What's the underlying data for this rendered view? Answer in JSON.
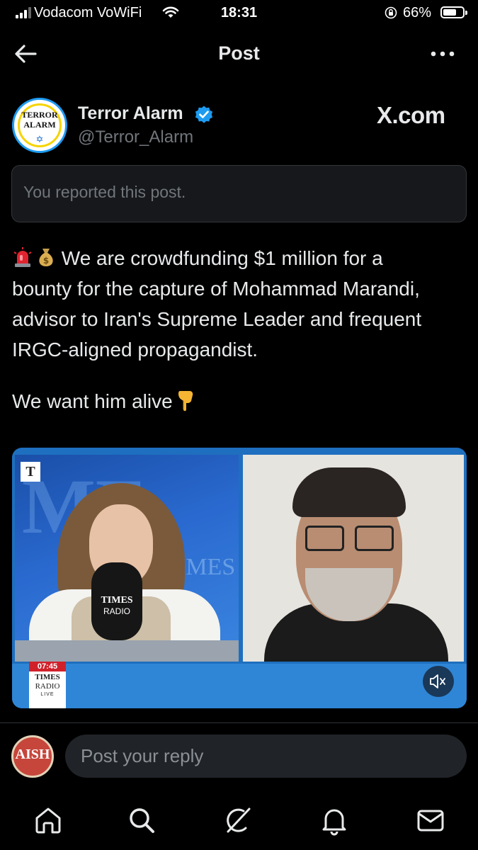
{
  "status_bar": {
    "carrier": "Vodacom VoWiFi",
    "time": "18:31",
    "battery": "66%",
    "battery_level": 0.66
  },
  "header": {
    "title": "Post",
    "back_icon": "back-arrow-icon",
    "more_icon": "more-horizontal-icon"
  },
  "author": {
    "avatar_line1": "TERROR",
    "avatar_line2": "ALARM",
    "avatar_star": "✡",
    "name": "Terror Alarm",
    "handle": "@Terror_Alarm",
    "verified_icon": "verified-badge-icon"
  },
  "watermark": "X.com",
  "reported_notice": "You reported this post.",
  "tweet": {
    "line1": "We are crowdfunding $1 million for a",
    "line2": "bounty for the capture of Mohammad Marandi,",
    "line3": "advisor to Iran's Supreme Leader and frequent",
    "line4": "IRGC-aligned propagandist.",
    "line5": "We want him alive",
    "emojis": [
      "siren-emoji",
      "money-bag-emoji",
      "pointing-down-emoji"
    ]
  },
  "media": {
    "t_logo": "T",
    "bg_letters": "ME",
    "bg_text": "IMES",
    "mic_line1": "TIMES",
    "mic_line2": "RADIO",
    "live_time": "07:45",
    "live_times": "TIMES",
    "live_radio": "RADIO",
    "live_label": "LIVE",
    "mute_icon": "volume-muted-icon"
  },
  "reply": {
    "avatar_text": "AISH",
    "placeholder": "Post your reply"
  },
  "bottom_nav": {
    "items": [
      "home-icon",
      "search-icon",
      "grok-icon",
      "notifications-icon",
      "messages-icon"
    ]
  },
  "colors": {
    "background": "#000000",
    "text": "#e7e9ea",
    "muted": "#71767b",
    "accent": "#1d9bf0",
    "media_frame": "#2f86d6"
  }
}
